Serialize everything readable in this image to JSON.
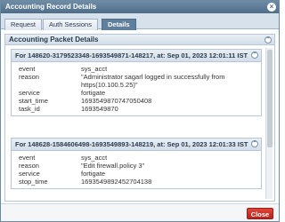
{
  "window": {
    "title": "Accounting Record Details"
  },
  "tabs": [
    {
      "label": "Request"
    },
    {
      "label": "Auth Sessions"
    },
    {
      "label": "Details"
    }
  ],
  "section": {
    "title": "Accounting Packet Details"
  },
  "records": [
    {
      "header": "For 148620-3179523348-1693549871-148217, at: Sep 01, 2023 12:01:11 IST",
      "fields": [
        {
          "key": "event",
          "value": "sys_acct"
        },
        {
          "key": "reason",
          "value": "\"Administrator sagarl logged in successfully from https(10.100.5.25)\""
        },
        {
          "key": "service",
          "value": "fortigate"
        },
        {
          "key": "start_time",
          "value": "1693549870747050408"
        },
        {
          "key": "task_id",
          "value": "1693549870"
        }
      ]
    },
    {
      "header": "For 148628-1584606498-1693549893-148219, at: Sep 01, 2023 12:01:33 IST",
      "fields": [
        {
          "key": "event",
          "value": "sys_acct"
        },
        {
          "key": "reason",
          "value": "\"Edit firewall.policy 3\""
        },
        {
          "key": "service",
          "value": "fortigate"
        },
        {
          "key": "stop_time",
          "value": "1693549892452704138"
        }
      ]
    }
  ],
  "footer": {
    "close_label": "Close"
  },
  "colors": {
    "accent": "#5f7f9d",
    "close": "#c9302c"
  }
}
